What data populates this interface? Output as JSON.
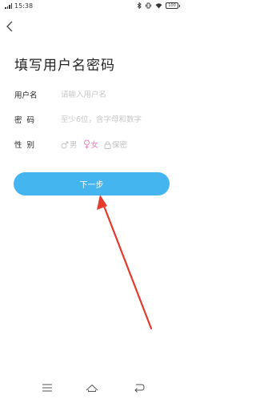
{
  "status_bar": {
    "time": "15:38",
    "battery": "100"
  },
  "page": {
    "title": "填写用户名密码"
  },
  "form": {
    "username_label": "用户名",
    "username_placeholder": "请输入用户名",
    "password_label": "密  码",
    "password_placeholder": "至少6位，含字母和数字",
    "gender_label": "性  别",
    "gender_options": [
      "男",
      "女",
      "保密"
    ],
    "selected_gender": "女"
  },
  "next_button_label": "下一步",
  "colors": {
    "accent": "#44b5ee",
    "female": "#e87fbf",
    "annotation_arrow": "#e53a2e",
    "placeholder": "#c7c7c7"
  },
  "icons": [
    "back-icon",
    "male-icon",
    "female-icon",
    "lock-icon",
    "menu-icon",
    "home-icon",
    "back-nav-icon",
    "bluetooth-icon",
    "vibrate-icon",
    "wifi-icon",
    "signal-icon"
  ]
}
